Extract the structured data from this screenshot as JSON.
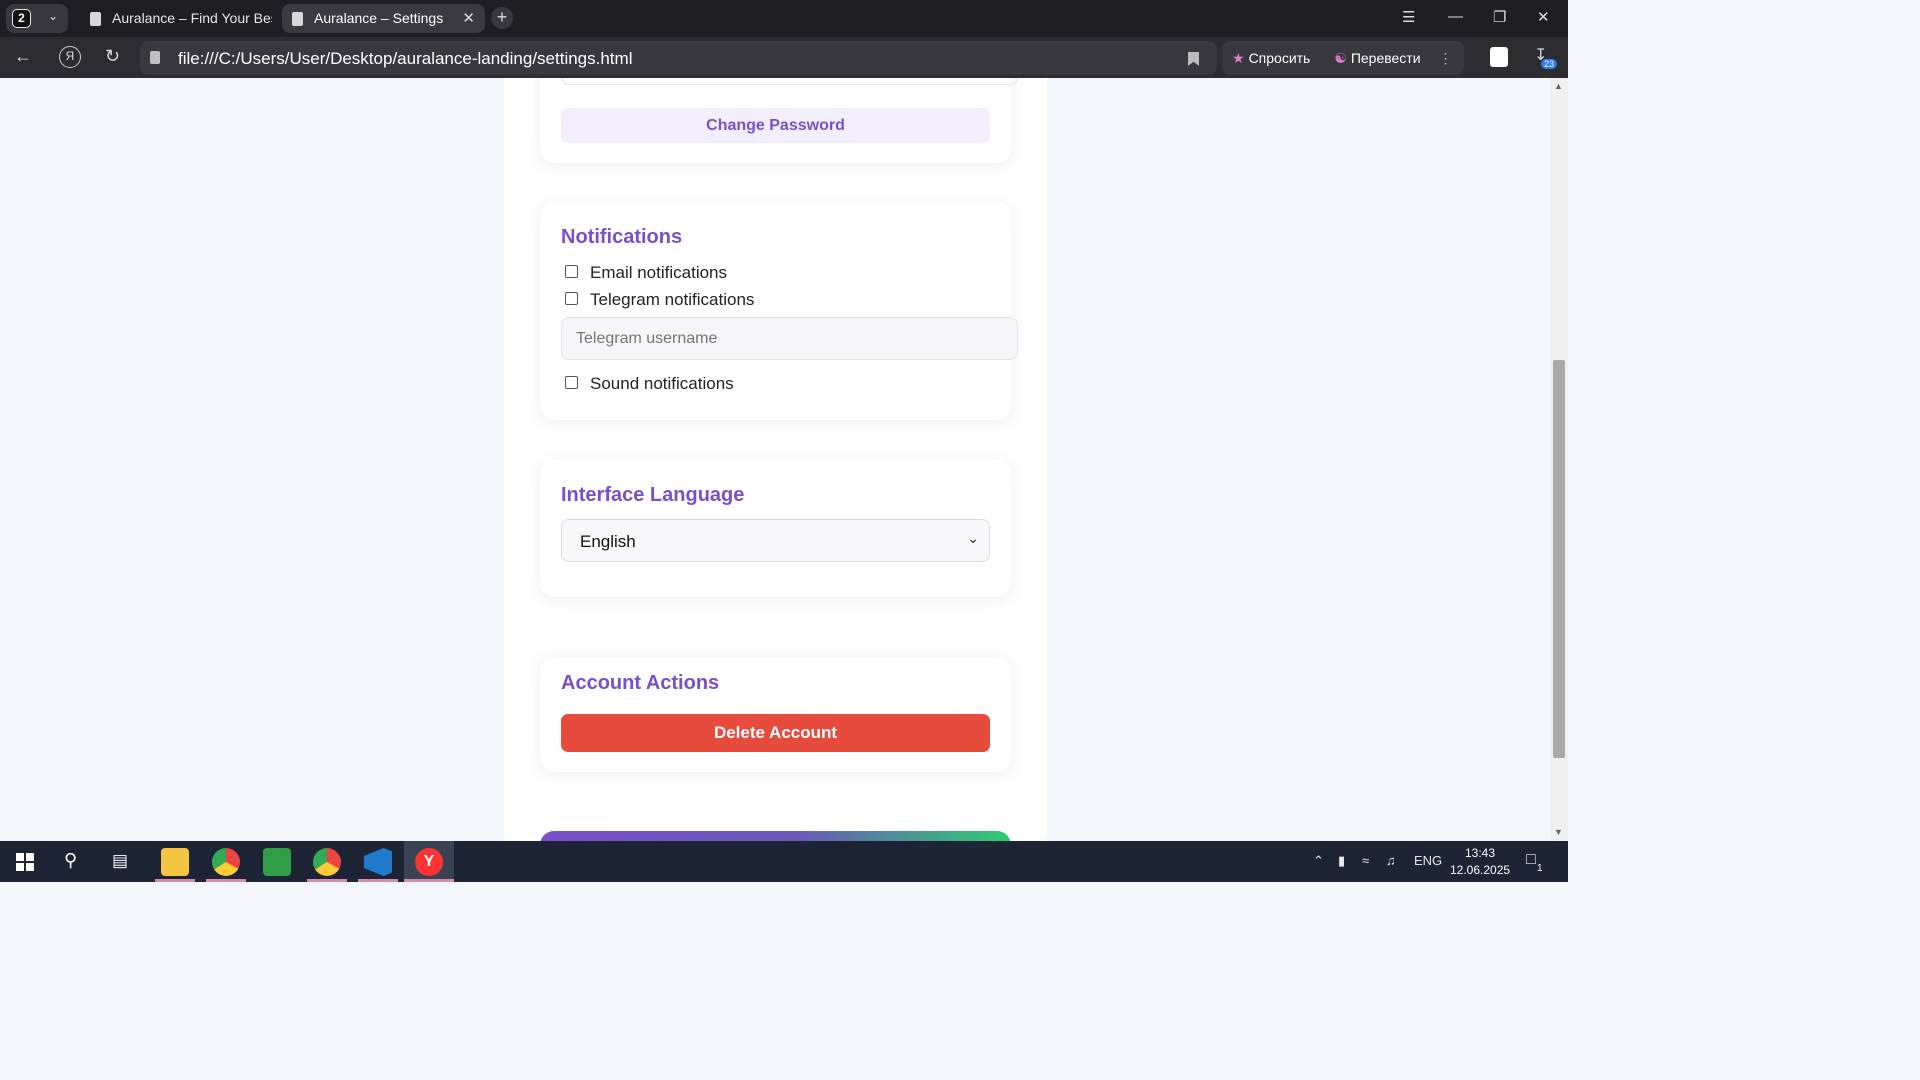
{
  "browser": {
    "tab_count": "2",
    "tabs": [
      {
        "title": "Auralance – Find Your Best",
        "active": false
      },
      {
        "title": "Auralance – Settings",
        "active": true
      }
    ],
    "url": "file:///C:/Users/User/Desktop/auralance-landing/settings.html",
    "ask_label": "Спросить",
    "translate_label": "Перевести",
    "downloads_badge": "23"
  },
  "security": {
    "change_password_label": "Change Password"
  },
  "notifications": {
    "title": "Notifications",
    "email_label": "Email notifications",
    "email_checked": false,
    "telegram_label": "Telegram notifications",
    "telegram_checked": false,
    "telegram_placeholder": "Telegram username",
    "sound_label": "Sound notifications",
    "sound_checked": false
  },
  "language": {
    "title": "Interface Language",
    "selected": "English"
  },
  "account": {
    "title": "Account Actions",
    "delete_label": "Delete Account"
  },
  "taskbar": {
    "lang": "ENG",
    "time": "13:43",
    "date": "12.06.2025",
    "notif_count": "1"
  },
  "colors": {
    "accent": "#7a4fc9",
    "danger": "#e64b3c",
    "success": "#2ecc71"
  }
}
